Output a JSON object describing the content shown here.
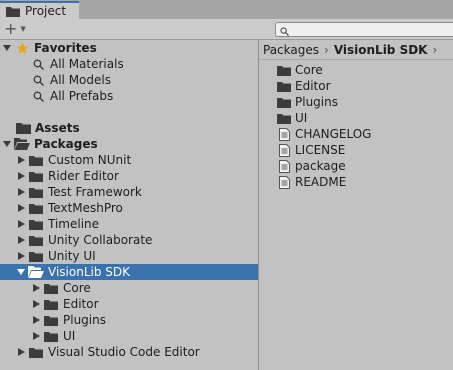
{
  "tab": {
    "label": "Project",
    "icon": "folder-icon"
  },
  "toolbar": {
    "add_icon": "plus-icon",
    "search": {
      "placeholder": ""
    }
  },
  "tree": {
    "favorites": {
      "label": "Favorites",
      "items": [
        "All Materials",
        "All Models",
        "All Prefabs"
      ]
    },
    "assets": {
      "label": "Assets"
    },
    "packages": {
      "label": "Packages",
      "items": [
        "Custom NUnit",
        "Rider Editor",
        "Test Framework",
        "TextMeshPro",
        "Timeline",
        "Unity Collaborate",
        "Unity UI",
        "VisionLib SDK",
        "Visual Studio Code Editor"
      ],
      "selected": "VisionLib SDK",
      "visionlib_children": [
        "Core",
        "Editor",
        "Plugins",
        "UI"
      ]
    }
  },
  "breadcrumb": {
    "items": [
      "Packages",
      "VisionLib SDK"
    ]
  },
  "content": {
    "folders": [
      "Core",
      "Editor",
      "Plugins",
      "UI"
    ],
    "files": [
      "CHANGELOG",
      "LICENSE",
      "package",
      "README"
    ]
  },
  "colors": {
    "selection": "#3a72b0",
    "star": "#e8a51c"
  }
}
